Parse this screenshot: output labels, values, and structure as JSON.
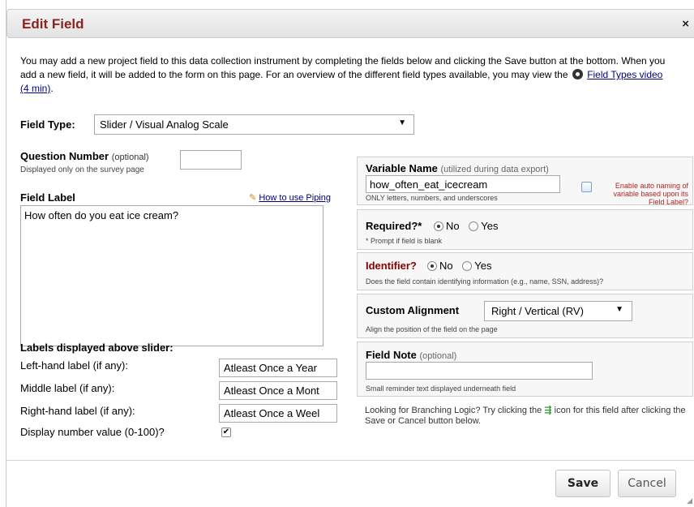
{
  "dialog": {
    "title": "Edit Field",
    "close": "×"
  },
  "intro": {
    "text": "You may add a new project field to this data collection instrument by completing the fields below and clicking the Save button at the bottom. When you add a new field, it will be added to the form on this page. For an overview of the different field types available, you may view the",
    "link": "Field Types video (4 min)",
    "end": "."
  },
  "field_type": {
    "label": "Field Type:",
    "value": "Slider / Visual Analog Scale",
    "arrow": "▼"
  },
  "question_number": {
    "label": "Question Number",
    "optional": "(optional)",
    "sub": "Displayed only on the survey page",
    "value": ""
  },
  "field_label": {
    "label": "Field Label",
    "piping_link": "How to use Piping",
    "value": "How often do you eat ice cream?"
  },
  "slider": {
    "title": "Labels displayed above slider:",
    "left_label": "Left-hand label (if any):",
    "left_value": "Atleast Once a Year",
    "middle_label": "Middle label (if any):",
    "middle_value": "Atleast Once a Mont",
    "right_label": "Right-hand label (if any):",
    "right_value": "Atleast Once a Weel",
    "display_number_label": "Display number value (0-100)?",
    "display_number_checked": true,
    "check": "✔"
  },
  "variable_name": {
    "label": "Variable Name",
    "hint": "(utilized during data export)",
    "value": "how_often_eat_icecream",
    "sub": "ONLY letters, numbers, and underscores",
    "auto_naming": "Enable auto naming of variable based upon its Field Label?"
  },
  "required": {
    "label": "Required?*",
    "no": "No",
    "yes": "Yes",
    "selected": "No",
    "sub": "* Prompt if field is blank"
  },
  "identifier": {
    "label": "Identifier?",
    "no": "No",
    "yes": "Yes",
    "selected": "No",
    "sub": "Does the field contain identifying information (e.g., name, SSN, address)?"
  },
  "alignment": {
    "label": "Custom Alignment",
    "value": "Right / Vertical (RV)",
    "arrow": "▼",
    "sub": "Align the position of the field on the page"
  },
  "field_note": {
    "label": "Field Note",
    "optional": "(optional)",
    "value": "",
    "sub": "Small reminder text displayed underneath field"
  },
  "branching": {
    "text_before": "Looking for Branching Logic? Try clicking the",
    "icon": "⇶",
    "text_after": "icon for this field after clicking the Save or Cancel button below."
  },
  "buttons": {
    "save": "Save",
    "cancel": "Cancel"
  }
}
